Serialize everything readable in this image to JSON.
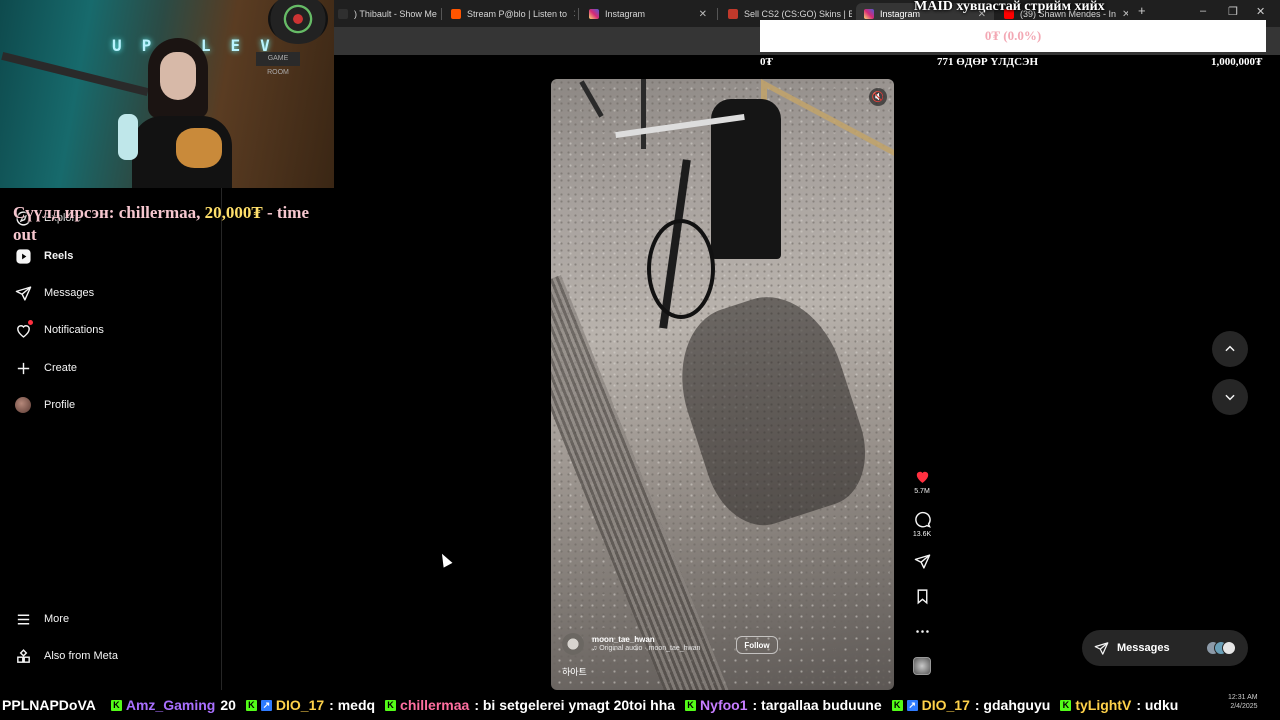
{
  "browser": {
    "tabs": [
      {
        "label": ") Thibault - Show Me t",
        "favicon_color": "#2f2f2f"
      },
      {
        "label": "Stream P@blo | Listen to",
        "favicon_color": "#ff5500"
      },
      {
        "label": "Instagram",
        "favicon_color": "#d62976"
      },
      {
        "label": "Sell CS2 (CS:GO) Skins | B",
        "favicon_color": "#c0392b"
      },
      {
        "label": "Instagram",
        "favicon_color": "#d62976"
      },
      {
        "label": "(39) Shawn Mendes - In",
        "favicon_color": "#ff0000"
      }
    ],
    "new_tab": "+",
    "win_min": "–",
    "win_max": "❐",
    "win_close": "✕"
  },
  "stream_overlay": {
    "goal_title": "MAID хувцастай стрийм хийх",
    "goal_progress_text": "0₮ (0.0%)",
    "goal_progress_fraction": 0.0,
    "goal_current": "0₮",
    "days_left": "771 ӨДӨР ҮЛДСЭН",
    "goal_target": "1,000,000₮",
    "alert_prefix": "Сүүлд ирсэн: chillermaa, ",
    "alert_amount": "20,000₮",
    "alert_suffix": " - time out",
    "webcam_sign": "UP LEV",
    "webcam_plate": "GAME ROOM"
  },
  "sidebar": {
    "items": [
      {
        "label": "Explore",
        "icon": "compass-icon"
      },
      {
        "label": "Reels",
        "icon": "reels-icon"
      },
      {
        "label": "Messages",
        "icon": "paper-plane-icon"
      },
      {
        "label": "Notifications",
        "icon": "heart-icon"
      },
      {
        "label": "Create",
        "icon": "plus-icon"
      },
      {
        "label": "Profile",
        "icon": "avatar"
      }
    ],
    "more_label": "More",
    "meta_label": "Also from Meta"
  },
  "reel": {
    "username": "moon_tae_hwan",
    "audio": "♫ Original audio · moon_tae_hwan",
    "follow_label": "Follow",
    "caption": "하아트",
    "likes": "5.7M",
    "comments": "13.6K",
    "like_color": "#ff3040"
  },
  "messages_pill": {
    "label": "Messages"
  },
  "chat": [
    {
      "user": "PPLNAPDoVA",
      "msg": "",
      "color": "#ffffff"
    },
    {
      "user": "Amz_Gaming",
      "msg": "20",
      "color": "#a970ff"
    },
    {
      "user": "DIO_17",
      "msg": ": medq",
      "color": "#ffd24a"
    },
    {
      "user": "chillermaa",
      "msg": ": bi setgelerei ymagt 20toi hha",
      "color": "#ff6fa0"
    },
    {
      "user": "Nyfoo1",
      "msg": ": targallaa buduune",
      "color": "#c77dff"
    },
    {
      "user": "DIO_17",
      "msg": ": gdahguyu",
      "color": "#ffd24a"
    },
    {
      "user": "tyLightV",
      "msg": ": udku",
      "color": "#ffd24a"
    }
  ],
  "clock": {
    "time": "12:31 AM",
    "date": "2/4/2025"
  }
}
